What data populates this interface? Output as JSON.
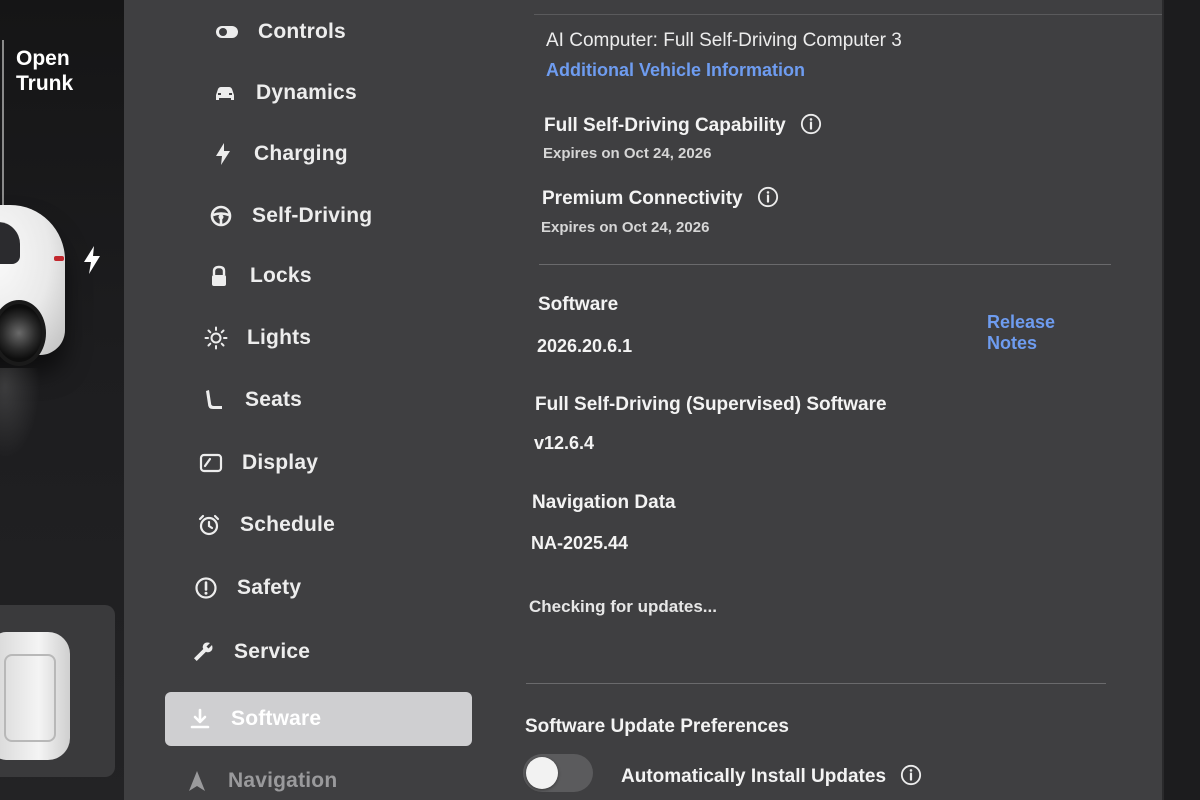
{
  "vehicle_panel": {
    "trunk_label": "Open\nTrunk"
  },
  "nav": {
    "items": [
      {
        "id": "controls",
        "label": "Controls",
        "icon": "toggle-icon"
      },
      {
        "id": "dynamics",
        "label": "Dynamics",
        "icon": "car-icon"
      },
      {
        "id": "charging",
        "label": "Charging",
        "icon": "bolt-icon"
      },
      {
        "id": "self-driving",
        "label": "Self-Driving",
        "icon": "steering-wheel-icon"
      },
      {
        "id": "locks",
        "label": "Locks",
        "icon": "lock-icon"
      },
      {
        "id": "lights",
        "label": "Lights",
        "icon": "sun-icon"
      },
      {
        "id": "seats",
        "label": "Seats",
        "icon": "seat-icon"
      },
      {
        "id": "display",
        "label": "Display",
        "icon": "display-icon"
      },
      {
        "id": "schedule",
        "label": "Schedule",
        "icon": "alarm-clock-icon"
      },
      {
        "id": "safety",
        "label": "Safety",
        "icon": "alert-circle-icon"
      },
      {
        "id": "service",
        "label": "Service",
        "icon": "wrench-icon"
      },
      {
        "id": "software",
        "label": "Software",
        "icon": "download-icon",
        "active": true
      },
      {
        "id": "navigation",
        "label": "Navigation",
        "icon": "navigation-arrow-icon"
      }
    ]
  },
  "software_page": {
    "ai_computer": "AI Computer: Full Self-Driving Computer 3",
    "additional_info_link": "Additional Vehicle Information",
    "fsd_capability": {
      "title": "Full Self-Driving Capability",
      "expires": "Expires on Oct 24, 2026"
    },
    "premium_connectivity": {
      "title": "Premium Connectivity",
      "expires": "Expires on Oct 24, 2026"
    },
    "software": {
      "title": "Software",
      "version": "2026.20.6.1",
      "release_notes_link": "Release Notes"
    },
    "fsd_software": {
      "title": "Full Self-Driving (Supervised) Software",
      "version": "v12.6.4"
    },
    "navigation_data": {
      "title": "Navigation Data",
      "version": "NA-2025.44"
    },
    "update_status": "Checking for updates...",
    "update_preferences": {
      "title": "Software Update Preferences",
      "auto_install_label": "Automatically Install Updates",
      "auto_install_enabled": false
    }
  },
  "colors": {
    "link": "#6e9cf0",
    "panel": "#3f3f41",
    "active_nav": "#cfcfd1"
  }
}
